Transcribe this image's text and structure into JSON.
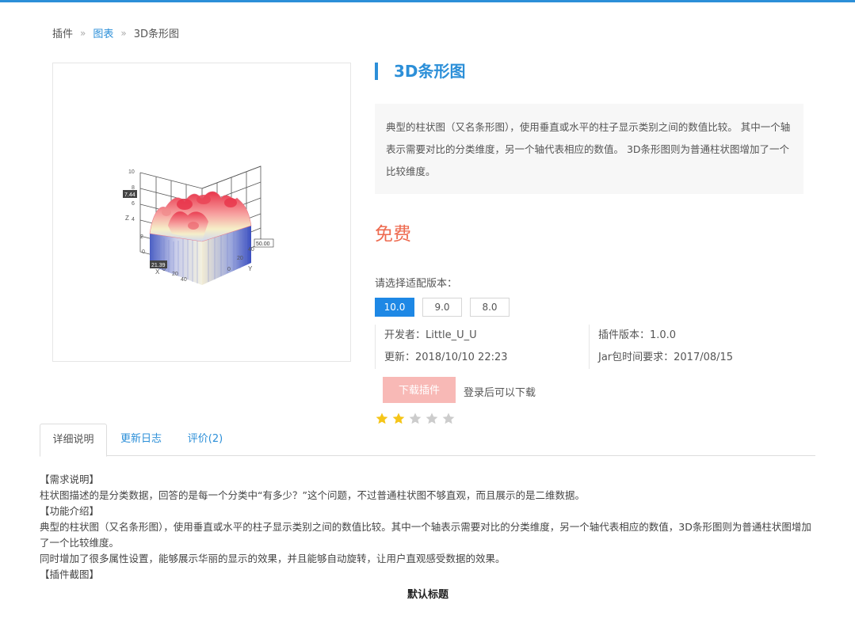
{
  "breadcrumb": {
    "root": "插件",
    "category": "图表",
    "current": "3D条形图",
    "separator": "»"
  },
  "thumbnail": {
    "axis_labels": {
      "z": "Z",
      "x": "X",
      "y": "Y"
    },
    "z_ticks": [
      "10",
      "8",
      "6",
      "4",
      "2",
      "0"
    ],
    "x_ticks": [
      "0",
      "20",
      "40"
    ],
    "y_ticks": [
      "0",
      "20",
      "40"
    ],
    "tooltip_left": "7.44",
    "tooltip_right": "50.00",
    "tooltip_bottom": "21.39"
  },
  "product": {
    "title": "3D条形图",
    "description": "典型的柱状图（又名条形图），使用垂直或水平的柱子显示类别之间的数值比较。 其中一个轴表示需要对比的分类维度，另一个轴代表相应的数值。 3D条形图则为普通柱状图增加了一个比较维度。",
    "price": "免费",
    "version_label": "请选择适配版本：",
    "versions": [
      {
        "label": "10.0",
        "active": true
      },
      {
        "label": "9.0",
        "active": false
      },
      {
        "label": "8.0",
        "active": false
      }
    ],
    "developer": "开发者：Little_U_U",
    "updated": "更新：2018/10/10 22:23",
    "plugin_version": "插件版本：1.0.0",
    "jar_requirement": "Jar包时间要求：2017/08/15",
    "download_label": "下载插件",
    "login_hint": "登录后可以下载",
    "rating": {
      "filled": 2,
      "total": 5,
      "filled_color": "#f5c518",
      "empty_color": "#cccccc"
    }
  },
  "tabs": [
    {
      "label": "详细说明",
      "active": true
    },
    {
      "label": "更新日志",
      "active": false
    },
    {
      "label": "评价(2)",
      "active": false
    }
  ],
  "details": {
    "h_requirement": "【需求说明】",
    "requirement": "柱状图描述的是分类数据，回答的是每一个分类中“有多少？”这个问题，不过普通柱状图不够直观，而且展示的是二维数据。",
    "h_feature": "【功能介绍】",
    "feature_1": "典型的柱状图（又名条形图），使用垂直或水平的柱子显示类别之间的数值比较。其中一个轴表示需要对比的分类维度，另一个轴代表相应的数值，3D条形图则为普通柱状图增加了一个比较维度。",
    "feature_2": "同时增加了很多属性设置，能够展示华丽的显示的效果，并且能够自动旋转，让用户直观感受数据的效果。",
    "h_screenshot": "【插件截图】",
    "screenshot_title": "默认标题"
  },
  "colors": {
    "accent": "#2c8fd8",
    "price": "#ee6a4f",
    "download_button": "#f8b9b6",
    "version_active": "#1e88e5"
  }
}
